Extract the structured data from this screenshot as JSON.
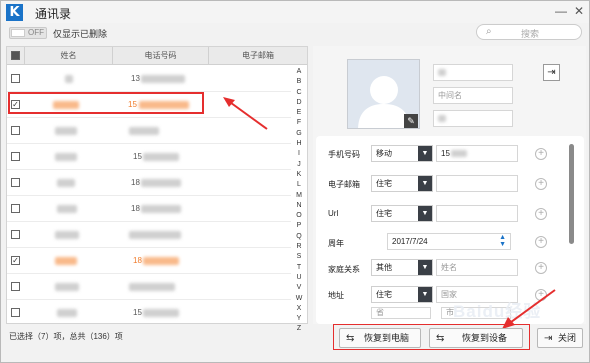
{
  "window": {
    "title": "通讯录",
    "logo_letter": "K"
  },
  "toolbar": {
    "toggle_text": "OFF",
    "only_deleted_label": "仅显示已删除",
    "search_placeholder": "搜索"
  },
  "list": {
    "headers": [
      "姓名",
      "电话号码",
      "电子邮箱"
    ],
    "rows": [
      {
        "checked": false,
        "phone_prefix": "13",
        "highlight": false
      },
      {
        "checked": true,
        "phone_prefix": "15",
        "highlight": true
      },
      {
        "checked": false,
        "phone_prefix": "",
        "highlight": false
      },
      {
        "checked": false,
        "phone_prefix": "15",
        "highlight": false
      },
      {
        "checked": false,
        "phone_prefix": "18",
        "highlight": false
      },
      {
        "checked": false,
        "phone_prefix": "18",
        "highlight": false
      },
      {
        "checked": false,
        "phone_prefix": "",
        "highlight": false
      },
      {
        "checked": true,
        "phone_prefix": "18",
        "highlight": true
      },
      {
        "checked": false,
        "phone_prefix": "",
        "highlight": false
      },
      {
        "checked": false,
        "phone_prefix": "15",
        "highlight": false
      },
      {
        "checked": false,
        "phone_prefix": "6",
        "highlight": false
      }
    ],
    "alphabet": [
      "A",
      "B",
      "C",
      "D",
      "E",
      "F",
      "G",
      "H",
      "I",
      "J",
      "K",
      "L",
      "M",
      "N",
      "O",
      "P",
      "Q",
      "R",
      "S",
      "T",
      "U",
      "V",
      "W",
      "X",
      "Y",
      "Z"
    ],
    "status": "已选择（7）项，总共（136）项"
  },
  "detail": {
    "middle_name_placeholder": "中间名",
    "fields": [
      {
        "label": "手机号码",
        "type": "移动",
        "value": "15"
      },
      {
        "label": "电子邮箱",
        "type": "住宅",
        "value": ""
      },
      {
        "label": "Url",
        "type": "住宅",
        "value": ""
      },
      {
        "label": "周年",
        "type": "",
        "value": "2017/7/24"
      },
      {
        "label": "家庭关系",
        "type": "其他",
        "value": "姓名"
      },
      {
        "label": "地址",
        "type": "住宅",
        "value": "国家"
      }
    ],
    "address_extra": [
      "省",
      "市"
    ]
  },
  "buttons": {
    "restore_pc": "恢复到电脑",
    "restore_device": "恢复到设备",
    "close": "关闭"
  },
  "watermark": "Baidu经验",
  "colors": {
    "accent": "#1a73c8",
    "highlight_orange": "#f07b2a",
    "annotation_red": "#e52e2e"
  }
}
